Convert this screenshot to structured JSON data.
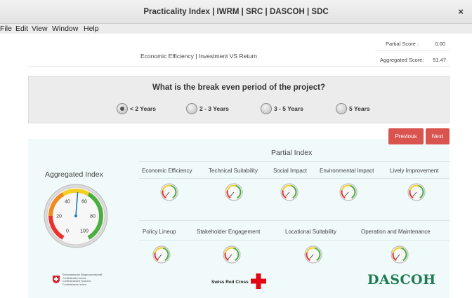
{
  "window": {
    "title": "Practicality Index | IWRM | SRC | DASCOH | SDC",
    "close_glyph": "×"
  },
  "menu": [
    "File",
    "Edit",
    "View",
    "Window",
    "Help"
  ],
  "header": {
    "partial_score_label": "Partial Score :",
    "partial_score_value": "0.00",
    "aggregated_score_label": "Aggregated Score:",
    "aggregated_score_value": "51.47",
    "subtitle": "Economic Efficiency | Investment VS Return"
  },
  "question": {
    "text": "What is the break even period of the project?",
    "options": [
      {
        "label": "< 2 Years",
        "selected": true
      },
      {
        "label": "2 - 3 Years",
        "selected": false
      },
      {
        "label": "3 - 5 Years",
        "selected": false
      },
      {
        "label": "5 Years",
        "selected": false
      }
    ]
  },
  "nav": {
    "previous": "Previous",
    "next": "Next",
    "button_color": "#d9534f"
  },
  "aggregated_index": {
    "title": "Aggregated Index",
    "value": 51.47,
    "ticks": [
      "0",
      "20",
      "40",
      "60",
      "80",
      "100"
    ]
  },
  "partial_index": {
    "title": "Partial Index",
    "row1": [
      {
        "label": "Economic Efficiency"
      },
      {
        "label": "Technical Suitability"
      },
      {
        "label": "Social Impact"
      },
      {
        "label": "Environmental Impact"
      },
      {
        "label": "Lively Improvement"
      }
    ],
    "row2": [
      {
        "label": "Policy Lineup"
      },
      {
        "label": "Stakeholder Engagement"
      },
      {
        "label": "Locational Suitability"
      },
      {
        "label": "Operation and Maintenance"
      }
    ]
  },
  "footer": {
    "sdc_lines": [
      "Schweizerische Eidgenossenschaft",
      "Confédération suisse",
      "Confederazione Svizzera",
      "Confederaziun svizra"
    ],
    "swiss_red_cross": "Swiss Red Cross",
    "dascoh": "DASCOH"
  }
}
